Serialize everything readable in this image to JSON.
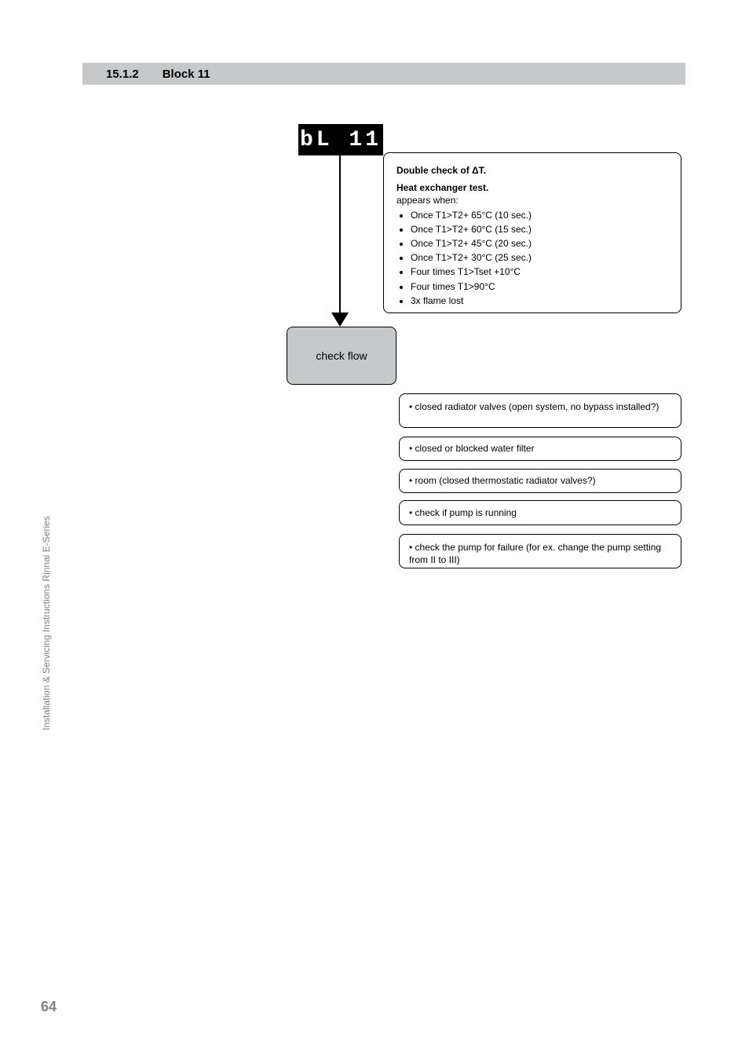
{
  "header": {
    "number": "15.1.2",
    "title": "Block 11"
  },
  "segment_display": "bL 11",
  "info": {
    "title_prefix": "Double check of ",
    "title_delta": "Δ",
    "title_suffix": "T.",
    "subtitle": "Heat exchanger test.",
    "list_intro": "appears when:",
    "items": [
      "Once T1>T2+ 65°C (10 sec.)",
      "Once T1>T2+ 60°C (15 sec.)",
      "Once T1>T2+ 45°C (20 sec.)",
      "Once T1>T2+ 30°C (25 sec.)",
      "Four times T1>Tset +10°C",
      "Four times T1>90°C",
      "3x flame lost"
    ]
  },
  "flow_label": "check flow",
  "causes": {
    "c1": "• closed radiator valves (open system, no bypass installed?)",
    "c2": "• closed or blocked water filter",
    "c3": "• room  (closed thermostatic radiator valves?)",
    "c4": "• check if pump is running",
    "c5": "• check the pump for failure (for ex. change the pump setting from II to III)"
  },
  "side_label": "Installation & Servicing Instructions Rinnai E-Series",
  "page_number": "64"
}
